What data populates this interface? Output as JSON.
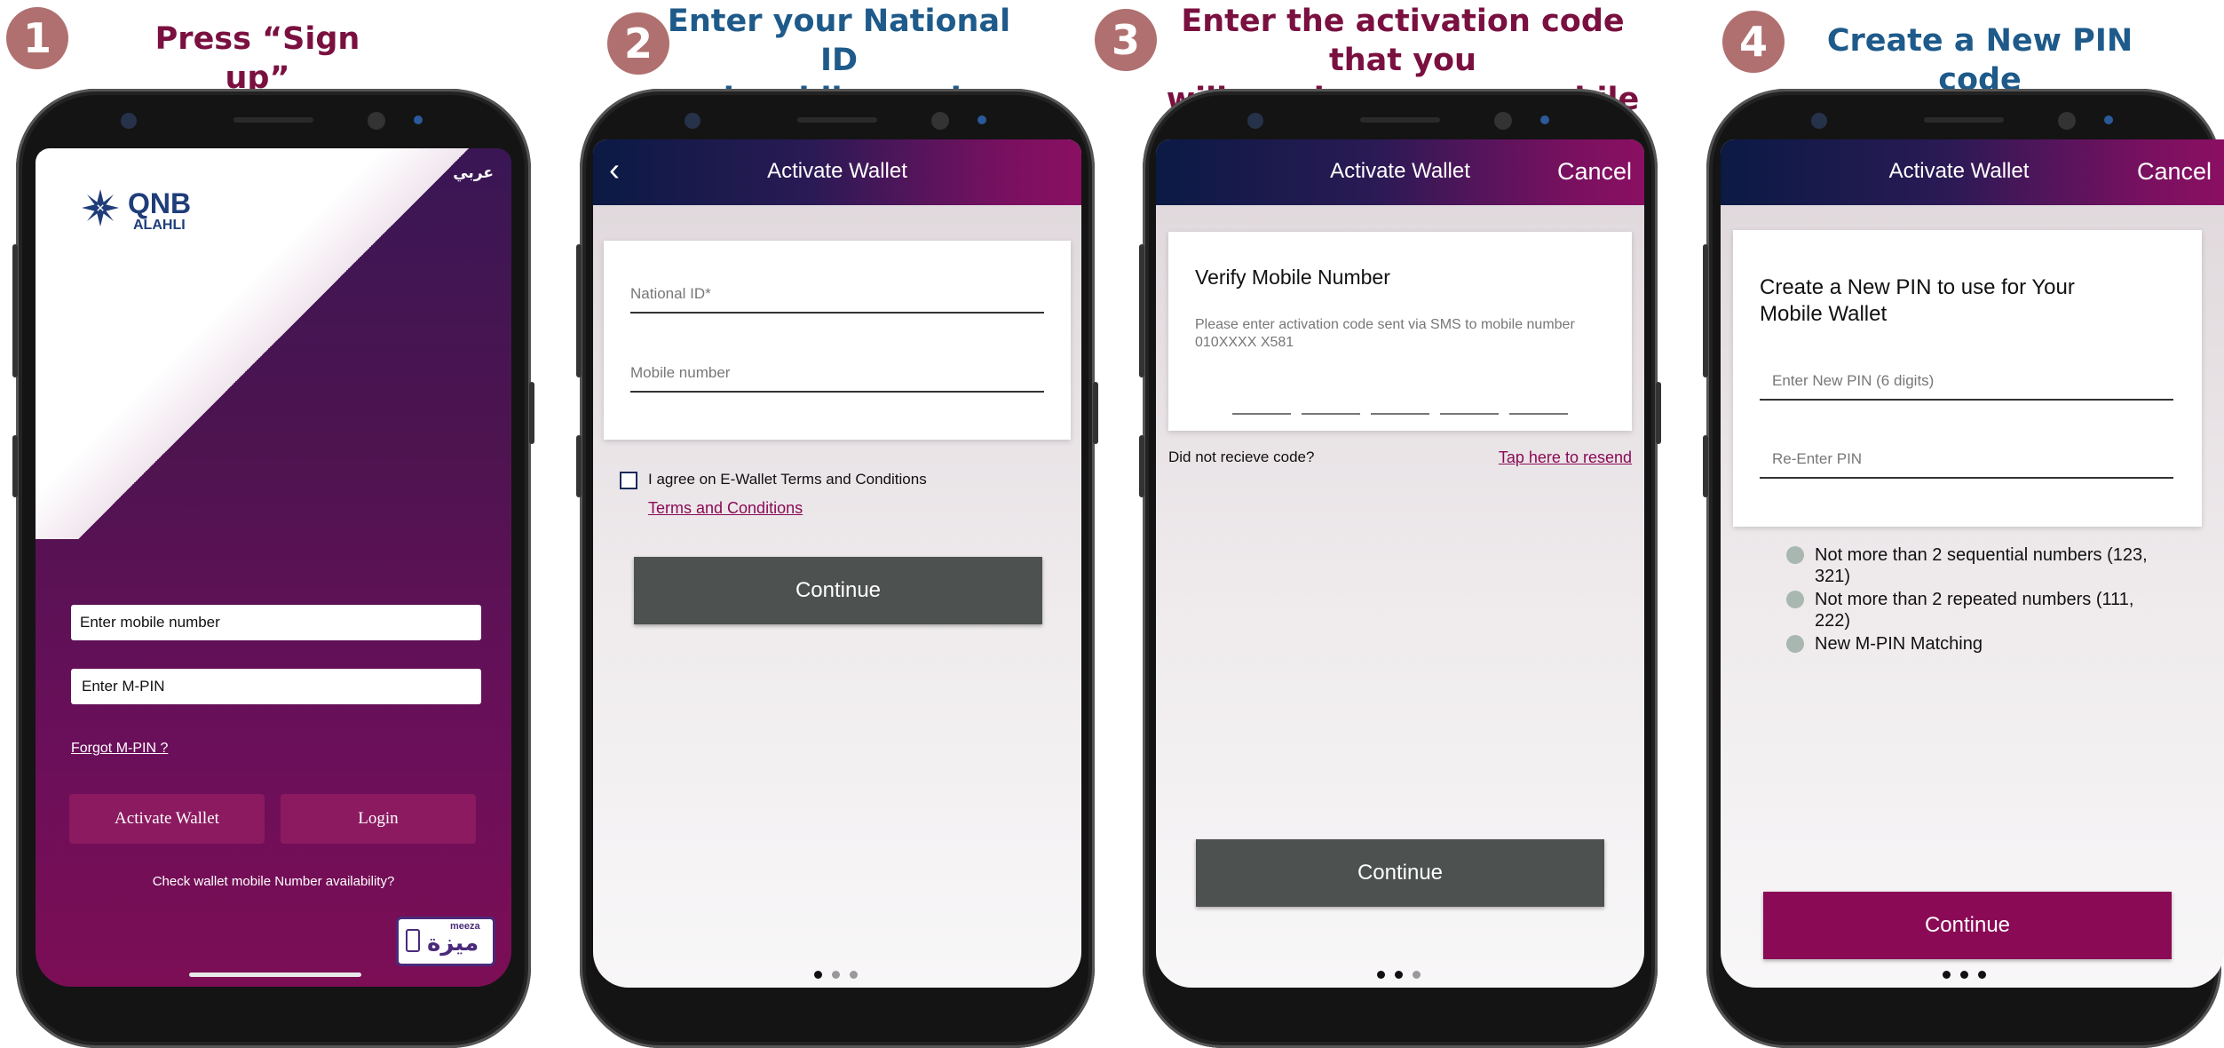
{
  "steps": [
    {
      "number": "1",
      "title": "Press “Sign up”",
      "color": "#7a1040"
    },
    {
      "number": "2",
      "title_l1": "Enter your National ID",
      "title_l2": "and mobile number",
      "color": "#1e5a8a"
    },
    {
      "number": "3",
      "title_l1": "Enter the activation code that you",
      "title_l2": "will receive on your mobile",
      "color": "#7a1040"
    },
    {
      "number": "4",
      "title": "Create a New PIN code",
      "color": "#1e5a8a"
    }
  ],
  "screen1": {
    "lang_toggle": "عربي",
    "logo_text": "QNB",
    "logo_sub": "ALAHLI",
    "mobile_placeholder": "Enter mobile number",
    "mpin_placeholder": "Enter M-PIN",
    "forgot_link": "Forgot M-PIN ?",
    "activate_button": "Activate Wallet",
    "login_button": "Login",
    "check_text": "Check wallet mobile Number availability?",
    "meeza_label": "meeza",
    "meeza_arabic": "ميزة"
  },
  "screen2": {
    "title": "Activate Wallet",
    "national_id_placeholder": "National ID*",
    "mobile_placeholder": "Mobile number",
    "agree_text": "I agree on E-Wallet Terms and Conditions",
    "terms_link": "Terms and Conditions",
    "continue_button": "Continue"
  },
  "screen3": {
    "title": "Activate Wallet",
    "cancel": "Cancel",
    "card_title": "Verify Mobile Number",
    "card_desc": "Please enter activation code sent via SMS to mobile number 010XXXX X581",
    "not_received": "Did not recieve code?",
    "resend_link": "Tap here to resend",
    "continue_button": "Continue"
  },
  "screen4": {
    "title": "Activate Wallet",
    "cancel": "Cancel",
    "card_title": "Create a New PIN to use for Your Mobile Wallet",
    "new_pin_placeholder": "Enter New PIN (6 digits)",
    "reenter_placeholder": "Re-Enter PIN",
    "rules": [
      "Not more than 2 sequential numbers (123, 321)",
      "Not more than 2 repeated numbers (111, 222)",
      "New M-PIN Matching"
    ],
    "continue_button": "Continue"
  },
  "colors": {
    "maroon": "#8a0a55",
    "navy": "#0b1a44",
    "step_circle": "#b07070",
    "dark_button": "#4d5150"
  }
}
